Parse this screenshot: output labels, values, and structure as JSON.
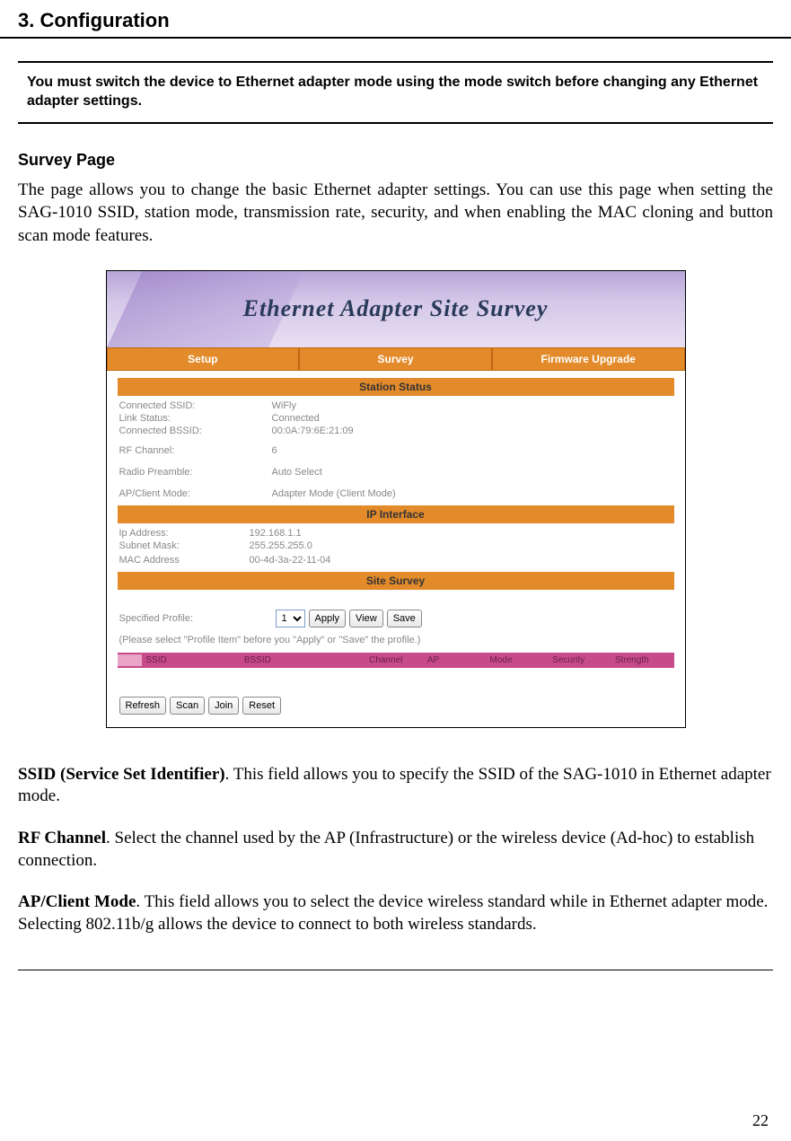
{
  "header": {
    "title": "3. Configuration"
  },
  "notice": "You must switch the device to Ethernet adapter mode using the mode switch before changing any Ethernet adapter settings.",
  "section": {
    "title": "Survey Page",
    "intro": "The page allows you to change the basic Ethernet adapter settings. You can use this page when setting the SAG-1010 SSID, station mode, transmission rate, security, and when enabling the MAC cloning and button scan mode features."
  },
  "screenshot": {
    "banner_title": "Ethernet Adapter Site Survey",
    "tabs": [
      "Setup",
      "Survey",
      "Firmware Upgrade"
    ],
    "sect_station": "Station Status",
    "station": [
      {
        "label": "Connected SSID:",
        "value": "WiFly"
      },
      {
        "label": "Link Status:",
        "value": "Connected"
      },
      {
        "label": "Connected BSSID:",
        "value": "00:0A:79:6E:21:09"
      },
      {
        "label": "RF Channel:",
        "value": "6"
      },
      {
        "label": "Radio Preamble:",
        "value": "Auto Select"
      },
      {
        "label": "AP/Client Mode:",
        "value": "Adapter Mode (Client Mode)"
      }
    ],
    "sect_ip": "IP Interface",
    "ip": [
      {
        "label": "Ip Address:",
        "value": "192.168.1.1"
      },
      {
        "label": "Subnet Mask:",
        "value": "255.255.255.0"
      },
      {
        "label": "MAC Address",
        "value": "00-4d-3a-22-11-04"
      }
    ],
    "sect_survey": "Site Survey",
    "profile_label": "Specified Profile:",
    "profile_value": "1",
    "btn_apply": "Apply",
    "btn_view": "View",
    "btn_save": "Save",
    "profile_note": "(Please select \"Profile Item\" before you \"Apply\" or \"Save\" the profile.)",
    "cols": {
      "ssid": "SSID",
      "bssid": "BSSID",
      "channel": "Channel",
      "ap": "AP",
      "mode": "Mode",
      "security": "Security",
      "strength": "Strength"
    },
    "btn_refresh": "Refresh",
    "btn_scan": "Scan",
    "btn_join": "Join",
    "btn_reset": "Reset"
  },
  "definitions": [
    {
      "term": "SSID (Service Set Identifier)",
      "desc": ". This field allows you to specify the SSID of the SAG-1010 in Ethernet adapter mode."
    },
    {
      "term": "RF Channel",
      "desc": ". Select the channel used by the AP (Infrastructure) or the wireless device (Ad-hoc) to establish connection."
    },
    {
      "term": "AP/Client Mode",
      "desc": ". This field allows you to select the device wireless standard while in Ethernet adapter mode. Selecting 802.11b/g allows the device to connect to both wireless standards."
    }
  ],
  "page_number": "22"
}
